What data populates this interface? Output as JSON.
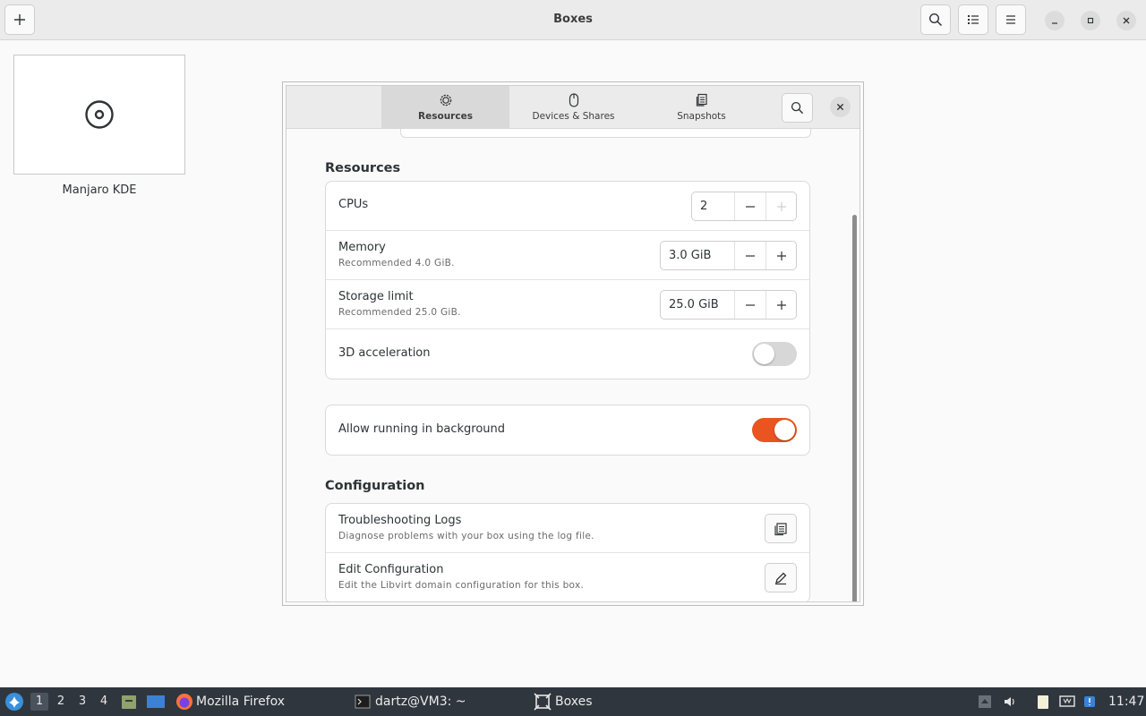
{
  "app": {
    "title": "Boxes"
  },
  "boxes": [
    {
      "name": "Manjaro KDE"
    }
  ],
  "dialog": {
    "tabs": [
      {
        "label": "Resources",
        "active": true
      },
      {
        "label": "Devices & Shares",
        "active": false
      },
      {
        "label": "Snapshots",
        "active": false
      }
    ],
    "resources": {
      "title": "Resources",
      "cpus": {
        "label": "CPUs",
        "value": "2"
      },
      "memory": {
        "label": "Memory",
        "subtitle": "Recommended 4.0 GiB.",
        "value": "3.0 GiB"
      },
      "storage": {
        "label": "Storage limit",
        "subtitle": "Recommended 25.0 GiB.",
        "value": "25.0 GiB"
      },
      "acceleration": {
        "label": "3D acceleration",
        "enabled": false
      },
      "background": {
        "label": "Allow running in background",
        "enabled": true
      }
    },
    "configuration": {
      "title": "Configuration",
      "logs": {
        "label": "Troubleshooting Logs",
        "subtitle": "Diagnose problems with your box using the log file."
      },
      "edit": {
        "label": "Edit Configuration",
        "subtitle": "Edit the Libvirt domain configuration for this box."
      }
    }
  },
  "taskbar": {
    "workspaces": [
      "1",
      "2",
      "3",
      "4"
    ],
    "tasks": [
      {
        "label": "Mozilla Firefox",
        "icon": "firefox-icon"
      },
      {
        "label": "dartz@VM3: ~",
        "icon": "terminal-icon"
      },
      {
        "label": "Boxes",
        "icon": "boxes-icon"
      }
    ],
    "clock": "11:47"
  },
  "colors": {
    "accent": "#e95420",
    "taskbar": "#30363d"
  }
}
